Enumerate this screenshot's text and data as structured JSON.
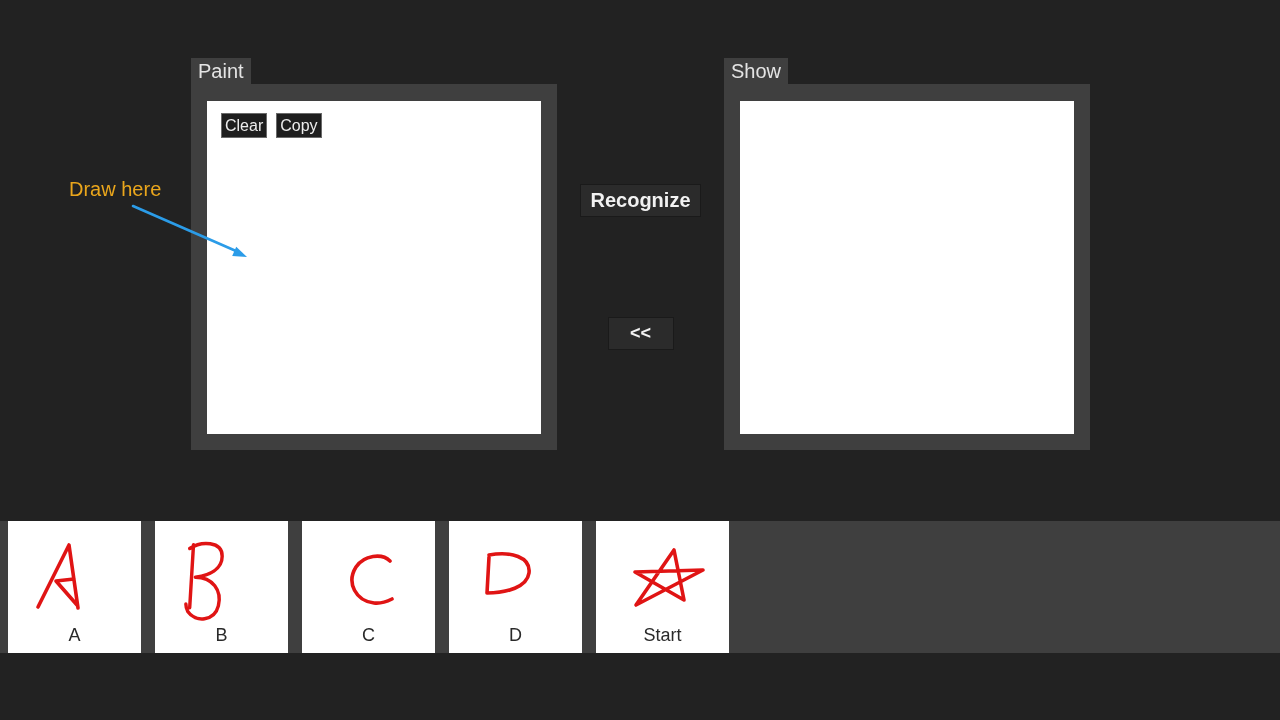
{
  "annotation": {
    "text": "Draw here"
  },
  "panels": [
    {
      "title": "Paint",
      "tools": [
        "Clear",
        "Copy"
      ]
    },
    {
      "title": "Show"
    }
  ],
  "actions": [
    "Recognize",
    "<<"
  ],
  "samples": [
    {
      "kind": "a",
      "label": "A"
    },
    {
      "kind": "b",
      "label": "B"
    },
    {
      "kind": "c",
      "label": "C"
    },
    {
      "kind": "d",
      "label": "D"
    },
    {
      "kind": "star",
      "label": "Start"
    }
  ]
}
